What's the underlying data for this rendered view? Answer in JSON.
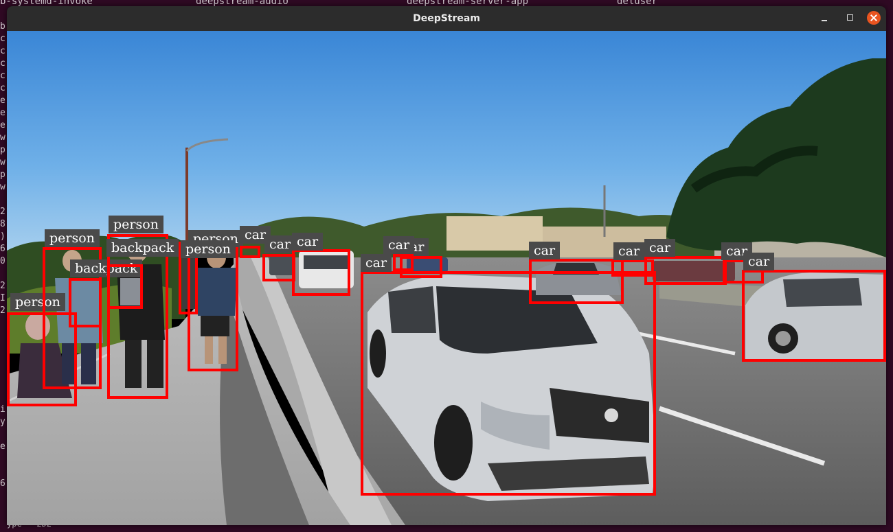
{
  "window": {
    "title": "DeepStream"
  },
  "terminal_top": [
    "b-systemd-invoke",
    "deepstream-audio",
    "deepstream-server-app",
    "deluser"
  ],
  "terminal_left": [
    "b",
    "c",
    "c",
    "c",
    "c",
    "c",
    "e",
    "e",
    "e",
    "w",
    "p",
    "w",
    "p",
    "w",
    "",
    "2",
    "8",
    ")",
    "6",
    "0",
    "",
    "2",
    "I",
    "2",
    "",
    "",
    "",
    "",
    "",
    "",
    "",
    "i",
    "y",
    "",
    "e",
    "",
    "",
    "6"
  ],
  "terminal_bottom": "ype - 2D2",
  "colors": {
    "box": "#ff0000",
    "label_bg": "#4a4a4a",
    "close_button": "#e95420"
  },
  "detections": [
    {
      "label": "person"
    },
    {
      "label": "person"
    },
    {
      "label": "backpack"
    },
    {
      "label": "person"
    },
    {
      "label": "backpack"
    },
    {
      "label": "person"
    },
    {
      "label": "person"
    },
    {
      "label": "car"
    },
    {
      "label": "car"
    },
    {
      "label": "car"
    },
    {
      "label": "car"
    },
    {
      "label": "ar"
    },
    {
      "label": "car"
    },
    {
      "label": "car"
    },
    {
      "label": "car"
    },
    {
      "label": "car"
    },
    {
      "label": "car"
    },
    {
      "label": "car"
    }
  ]
}
